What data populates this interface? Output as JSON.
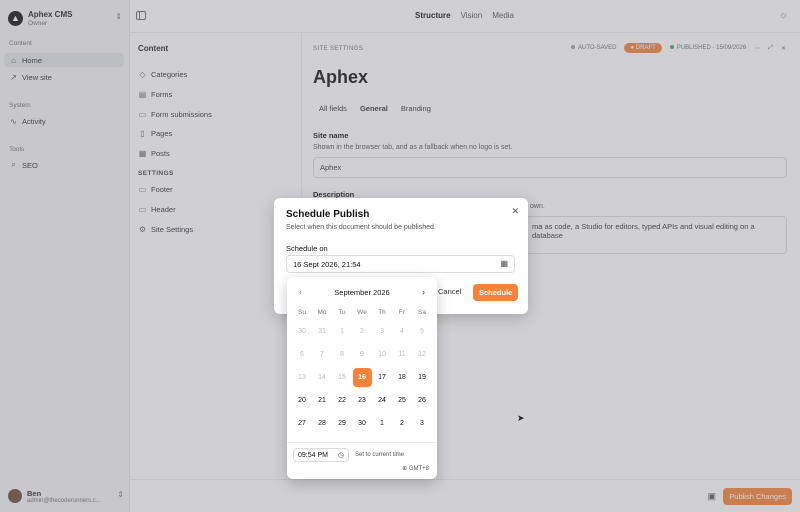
{
  "sidebar": {
    "brand_title": "Aphex CMS",
    "brand_role": "Owner",
    "sections": {
      "content": "Content",
      "system": "System",
      "tools": "Tools"
    },
    "items": [
      {
        "label": "Home",
        "icon": "home-icon"
      },
      {
        "label": "View site",
        "icon": "external-link-icon"
      },
      {
        "label": "Activity",
        "icon": "activity-icon"
      },
      {
        "label": "SEO",
        "icon": "search-icon"
      }
    ],
    "user": {
      "name": "Ben",
      "email": "admin@thecoderunners.c..."
    }
  },
  "topbar": {
    "tabs": [
      "Structure",
      "Vision",
      "Media"
    ],
    "active_tab": "Structure"
  },
  "content_pane": {
    "title": "Content",
    "items": [
      "Categories",
      "Forms",
      "Form submissions",
      "Pages",
      "Posts"
    ],
    "settings_section": "SETTINGS",
    "settings_items": [
      "Footer",
      "Header",
      "Site Settings"
    ]
  },
  "document": {
    "label": "SITE SETTINGS",
    "auto_saved": "AUTO-SAVED",
    "draft_badge": "DRAFT",
    "published": "PUBLISHED · 15/09/2026",
    "title": "Aphex",
    "tabs": [
      "All fields",
      "General",
      "Branding"
    ],
    "site_name_label": "Site name",
    "site_name_help": "Shown in the browser tab, and as a fallback when no logo is set.",
    "site_name_value": "Aphex",
    "description_label": "Description",
    "description_help_tail": "own.",
    "description_value_tail": "ma as code, a Studio for editors, typed APIs and visual editing on a database"
  },
  "bottombar": {
    "publish_label": "Publish Changes"
  },
  "dialog": {
    "title": "Schedule Publish",
    "subtitle": "Select when this document should be published.",
    "schedule_label": "Schedule on",
    "schedule_value": "16 Sept 2026, 21:54",
    "cancel_label": "Cancel",
    "schedule_button": "Schedule"
  },
  "calendar": {
    "month": "September 2026",
    "weekdays": [
      "Su",
      "Mo",
      "Tu",
      "We",
      "Th",
      "Fr",
      "Sa"
    ],
    "weeks": [
      [
        {
          "d": "30",
          "dim": true
        },
        {
          "d": "31",
          "dim": true
        },
        {
          "d": "1",
          "dim": true
        },
        {
          "d": "2",
          "dim": true
        },
        {
          "d": "3",
          "dim": true
        },
        {
          "d": "4",
          "dim": true
        },
        {
          "d": "5",
          "dim": true
        }
      ],
      [
        {
          "d": "6",
          "dim": true
        },
        {
          "d": "7",
          "dim": true
        },
        {
          "d": "8",
          "dim": true
        },
        {
          "d": "9",
          "dim": true
        },
        {
          "d": "10",
          "dim": true
        },
        {
          "d": "11",
          "dim": true
        },
        {
          "d": "12",
          "dim": true
        }
      ],
      [
        {
          "d": "13",
          "dim": true
        },
        {
          "d": "14",
          "dim": true
        },
        {
          "d": "15",
          "dim": true
        },
        {
          "d": "16",
          "sel": true
        },
        {
          "d": "17"
        },
        {
          "d": "18"
        },
        {
          "d": "19"
        }
      ],
      [
        {
          "d": "20"
        },
        {
          "d": "21"
        },
        {
          "d": "22"
        },
        {
          "d": "23"
        },
        {
          "d": "24"
        },
        {
          "d": "25"
        },
        {
          "d": "26"
        }
      ],
      [
        {
          "d": "27"
        },
        {
          "d": "28"
        },
        {
          "d": "29"
        },
        {
          "d": "30"
        },
        {
          "d": "1"
        },
        {
          "d": "2"
        },
        {
          "d": "3"
        }
      ]
    ],
    "time_value": "09:54 PM",
    "set_current": "Set to current time",
    "timezone": "GMT+8"
  },
  "colors": {
    "accent": "#f5823a",
    "published_dot": "#3aa76d",
    "autosave_dot": "#9aa0a6"
  }
}
